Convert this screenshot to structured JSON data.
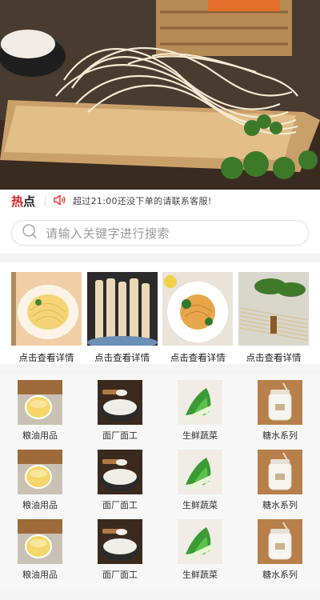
{
  "hotbar": {
    "hot_label": "热",
    "hot_label_b": "点",
    "notice": "超过21:00还没下单的请联系客服!"
  },
  "search": {
    "placeholder": "请输入关键字进行搜索"
  },
  "featured": [
    {
      "label": "点击查看详情"
    },
    {
      "label": "点击查看详情"
    },
    {
      "label": "点击查看详情"
    },
    {
      "label": "点击查看详情"
    }
  ],
  "categories": [
    {
      "label": "粮油用品"
    },
    {
      "label": "面厂面工"
    },
    {
      "label": "生鲜蔬菜"
    },
    {
      "label": "糖水系列"
    }
  ],
  "colors": {
    "accent": "#e02020",
    "background": "#f4f4f4"
  }
}
